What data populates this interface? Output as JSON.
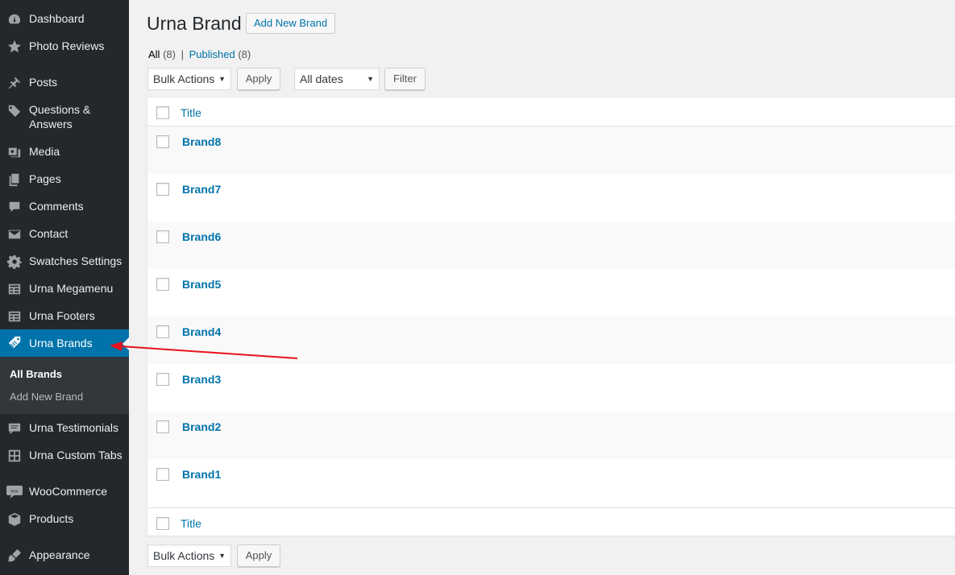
{
  "sidebar": {
    "items": [
      {
        "label": "Dashboard",
        "icon": "dashboard-icon"
      },
      {
        "label": "Photo Reviews",
        "icon": "star-icon"
      },
      {
        "label": "Posts",
        "icon": "pin-icon"
      },
      {
        "label": "Questions &\nAnswers",
        "icon": "tag-icon"
      },
      {
        "label": "Media",
        "icon": "media-icon"
      },
      {
        "label": "Pages",
        "icon": "pages-icon"
      },
      {
        "label": "Comments",
        "icon": "comment-icon"
      },
      {
        "label": "Contact",
        "icon": "envelope-icon"
      },
      {
        "label": "Swatches Settings",
        "icon": "gear-icon"
      },
      {
        "label": "Urna Megamenu",
        "icon": "list-icon"
      },
      {
        "label": "Urna Footers",
        "icon": "list-icon"
      },
      {
        "label": "Urna Brands",
        "icon": "tag-icon"
      },
      {
        "label": "Urna Testimonials",
        "icon": "testimonial-icon"
      },
      {
        "label": "Urna Custom Tabs",
        "icon": "grid-icon"
      },
      {
        "label": "WooCommerce",
        "icon": "woocommerce-icon"
      },
      {
        "label": "Products",
        "icon": "box-icon"
      },
      {
        "label": "Appearance",
        "icon": "brush-icon"
      }
    ],
    "submenu": [
      "All Brands",
      "Add New Brand"
    ]
  },
  "header": {
    "title": "Urna Brand",
    "add_new": "Add New Brand"
  },
  "filters": {
    "all": "All",
    "all_count": "(8)",
    "separator": "|",
    "published": "Published",
    "published_count": "(8)"
  },
  "tablenav": {
    "bulk_actions": "Bulk Actions",
    "apply": "Apply",
    "dates": "All dates",
    "filter": "Filter"
  },
  "table": {
    "column_title": "Title",
    "rows": [
      "Brand8",
      "Brand7",
      "Brand6",
      "Brand5",
      "Brand4",
      "Brand3",
      "Brand2",
      "Brand1"
    ]
  },
  "colors": {
    "sidebar_bg": "#23282d",
    "accent": "#0073aa",
    "annotation_arrow": "#e8121b"
  }
}
